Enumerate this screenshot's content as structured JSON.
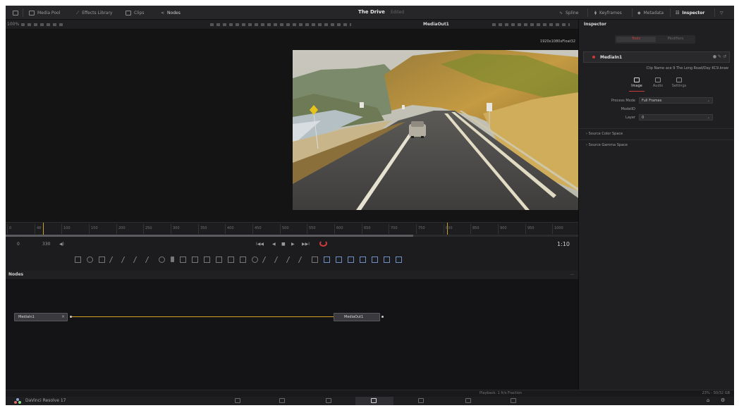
{
  "topbar": {
    "media_pool": "Media Pool",
    "effects_library": "Effects Library",
    "clips": "Clips",
    "nodes": "Nodes",
    "project_title": "The Drive",
    "project_status": "Edited",
    "splines": "Spline",
    "keyframes": "Keyframes",
    "metadata": "Metadata",
    "inspector": "Inspector"
  },
  "viewbar": {
    "zoom": "100%",
    "viewer_name": "MediaOut1"
  },
  "viewer": {
    "resolution": "1920x1080xFloat32"
  },
  "ruler": {
    "ticks": [
      "0",
      "48",
      "100",
      "150",
      "200",
      "250",
      "300",
      "350",
      "400",
      "450",
      "500",
      "550",
      "600",
      "650",
      "700",
      "750",
      "800",
      "850",
      "900",
      "950",
      "1000"
    ]
  },
  "transport": {
    "start": "0",
    "end": "330",
    "timecode": "1:10",
    "buttons": [
      "I◀◀",
      "◀",
      "■",
      "▶",
      "▶▶I"
    ]
  },
  "nodes_panel": {
    "title": "Nodes",
    "more": "...",
    "node_in": "MediaIn1",
    "node_out": "MediaOut1"
  },
  "inspector": {
    "title": "Inspector",
    "tab_tools": "Tools",
    "tab_modifiers": "Modifiers",
    "node_name": "MediaIn1",
    "clip_name": "Clip Name  ace 9 The Long Road/Day KC9.braw",
    "subtabs": [
      "Image",
      "Audio",
      "Settings"
    ],
    "process_mode_label": "Process Mode",
    "process_mode_value": "Full Frames",
    "model_label": "ModelID",
    "layer_label": "Layer",
    "layer_value": "0",
    "section_color": "Source Color Space",
    "section_gamma": "Source Gamma Space"
  },
  "status": {
    "playback": "Playback: 1 fr/s  Fraction",
    "memory": "23% - 50/32 GB"
  },
  "pagebar": {
    "app_name": "DaVinci Resolve 17"
  },
  "colors": {
    "accent_red": "#d13b3b",
    "link_gold": "#d8a020"
  }
}
